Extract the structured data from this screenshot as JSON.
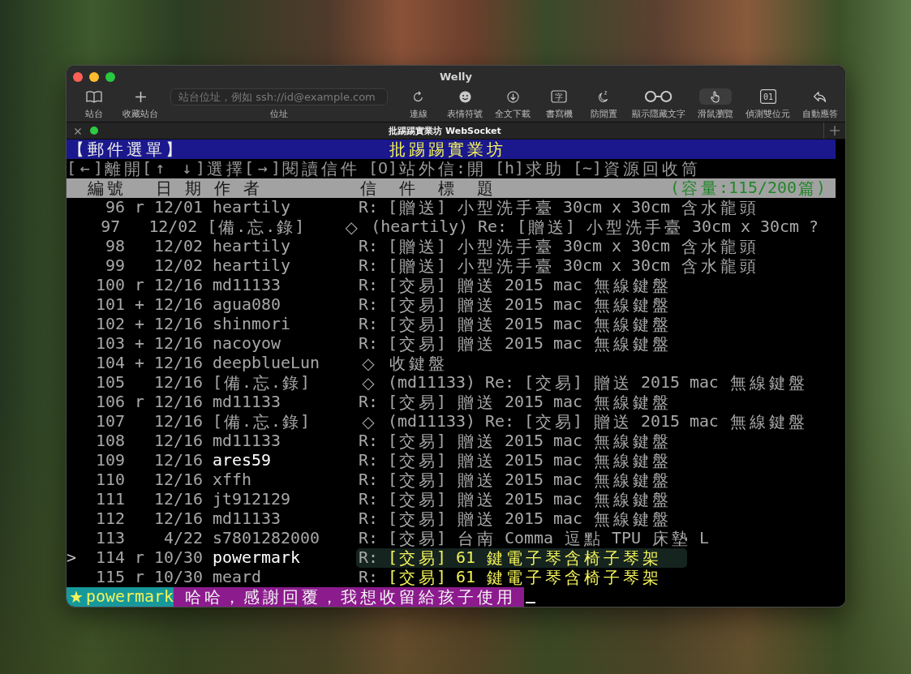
{
  "window": {
    "title": "Welly"
  },
  "toolbar": {
    "buttons_left": [
      {
        "label": "站台",
        "on": false
      },
      {
        "label": "收藏站台",
        "on": false
      }
    ],
    "address": {
      "placeholder": "站台位址，例如 ssh://id@example.com",
      "label": "位址"
    },
    "buttons_right": [
      {
        "label": "連線",
        "on": false
      },
      {
        "label": "表情符號",
        "on": false
      },
      {
        "label": "全文下載",
        "on": false
      },
      {
        "label": "書寫機",
        "on": false,
        "icon_text": "字"
      },
      {
        "label": "防閒置",
        "on": false
      },
      {
        "label": "顯示隱藏文字",
        "on": false
      },
      {
        "label": "滑鼠瀏覽",
        "on": true
      },
      {
        "label": "偵測雙位元",
        "on": false,
        "icon_text": "01"
      },
      {
        "label": "自動應答",
        "on": false
      }
    ]
  },
  "tab": {
    "title": "批踢踢實業坊 WebSocket",
    "connected": true
  },
  "terminal": {
    "menu_title": "【郵件選單】",
    "site_name": "批踢踢實業坊",
    "help_line": "[←]離開[↑ ↓]選擇[→]閱讀信件 [O]站外信:開 [h]求助 [~]資源回收筒",
    "columns": [
      "編號",
      "日 期",
      "作 者",
      "信  件  標  題"
    ],
    "capacity": "(容量:115/200篇)",
    "cursor": ">",
    "rows": [
      {
        "number": "96",
        "mark": "r",
        "date": "12/01",
        "author": "heartily",
        "author_highlighted": false,
        "prefix": "R:",
        "title": "[贈送] 小型洗手臺 30cm x 30cm 含水龍頭",
        "title_highlighted": false,
        "selected": false
      },
      {
        "number": "97",
        "date": "12/02",
        "author": "[備.忘.錄]",
        "author_highlighted": false,
        "prefix": "◇",
        "title": "(heartily) Re: [贈送] 小型洗手臺 30cm x 30cm ?",
        "title_highlighted": false,
        "selected": false
      },
      {
        "number": "98",
        "date": "12/02",
        "author": "heartily",
        "author_highlighted": false,
        "prefix": "R:",
        "title": "[贈送] 小型洗手臺 30cm x 30cm 含水龍頭",
        "title_highlighted": false,
        "selected": false
      },
      {
        "number": "99",
        "date": "12/02",
        "author": "heartily",
        "author_highlighted": false,
        "prefix": "R:",
        "title": "[贈送] 小型洗手臺 30cm x 30cm 含水龍頭",
        "title_highlighted": false,
        "selected": false
      },
      {
        "number": "100",
        "mark": "r",
        "date": "12/16",
        "author": "md11133",
        "author_highlighted": false,
        "prefix": "R:",
        "title": "[交易] 贈送 2015 mac 無線鍵盤",
        "title_highlighted": false,
        "selected": false
      },
      {
        "number": "101",
        "mark": "+",
        "date": "12/16",
        "author": "agua080",
        "author_highlighted": false,
        "prefix": "R:",
        "title": "[交易] 贈送 2015 mac 無線鍵盤",
        "title_highlighted": false,
        "selected": false
      },
      {
        "number": "102",
        "mark": "+",
        "date": "12/16",
        "author": "shinmori",
        "author_highlighted": false,
        "prefix": "R:",
        "title": "[交易] 贈送 2015 mac 無線鍵盤",
        "title_highlighted": false,
        "selected": false
      },
      {
        "number": "103",
        "mark": "+",
        "date": "12/16",
        "author": "nacoyow",
        "author_highlighted": false,
        "prefix": "R:",
        "title": "[交易] 贈送 2015 mac 無線鍵盤",
        "title_highlighted": false,
        "selected": false
      },
      {
        "number": "104",
        "mark": "+",
        "date": "12/16",
        "author": "deepblueLun",
        "author_highlighted": false,
        "prefix": "◇",
        "title": "收鍵盤",
        "title_highlighted": false,
        "selected": false
      },
      {
        "number": "105",
        "date": "12/16",
        "author": "[備.忘.錄]",
        "author_highlighted": false,
        "prefix": "◇",
        "title": "(md11133) Re: [交易] 贈送 2015 mac 無線鍵盤",
        "title_highlighted": false,
        "selected": false
      },
      {
        "number": "106",
        "mark": "r",
        "date": "12/16",
        "author": "md11133",
        "author_highlighted": false,
        "prefix": "R:",
        "title": "[交易] 贈送 2015 mac 無線鍵盤",
        "title_highlighted": false,
        "selected": false
      },
      {
        "number": "107",
        "date": "12/16",
        "author": "[備.忘.錄]",
        "author_highlighted": false,
        "prefix": "◇",
        "title": "(md11133) Re: [交易] 贈送 2015 mac 無線鍵盤",
        "title_highlighted": false,
        "selected": false
      },
      {
        "number": "108",
        "date": "12/16",
        "author": "md11133",
        "author_highlighted": false,
        "prefix": "R:",
        "title": "[交易] 贈送 2015 mac 無線鍵盤",
        "title_highlighted": false,
        "selected": false
      },
      {
        "number": "109",
        "date": "12/16",
        "author": "ares59",
        "author_highlighted": true,
        "prefix": "R:",
        "title": "[交易] 贈送 2015 mac 無線鍵盤",
        "title_highlighted": false,
        "selected": false
      },
      {
        "number": "110",
        "date": "12/16",
        "author": "xffh",
        "author_highlighted": false,
        "prefix": "R:",
        "title": "[交易] 贈送 2015 mac 無線鍵盤",
        "title_highlighted": false,
        "selected": false
      },
      {
        "number": "111",
        "date": "12/16",
        "author": "jt912129",
        "author_highlighted": false,
        "prefix": "R:",
        "title": "[交易] 贈送 2015 mac 無線鍵盤",
        "title_highlighted": false,
        "selected": false
      },
      {
        "number": "112",
        "date": "12/16",
        "author": "md11133",
        "author_highlighted": false,
        "prefix": "R:",
        "title": "[交易] 贈送 2015 mac 無線鍵盤",
        "title_highlighted": false,
        "selected": false
      },
      {
        "number": "113",
        "date": "4/22",
        "author": "s7801282000",
        "author_highlighted": false,
        "prefix": "R:",
        "title": "[交易] 台南 Comma 逗點 TPU 床墊 L",
        "title_highlighted": false,
        "selected": false
      },
      {
        "number": "114",
        "mark": "r",
        "date": "10/30",
        "author": "powermark",
        "author_highlighted": true,
        "prefix": "R:",
        "title": "[交易] 61 鍵電子琴含椅子琴架",
        "title_highlighted": true,
        "selected": true
      },
      {
        "number": "115",
        "mark": "r",
        "date": "10/30",
        "author": "meard",
        "author_highlighted": false,
        "prefix": "R:",
        "title": "[交易] 61 鍵電子琴含椅子琴架",
        "title_highlighted": true,
        "selected": false
      }
    ],
    "status_line": {
      "sender": "★powermark",
      "message": "哈哈，感謝回覆，我想收留給孩子使用"
    }
  }
}
